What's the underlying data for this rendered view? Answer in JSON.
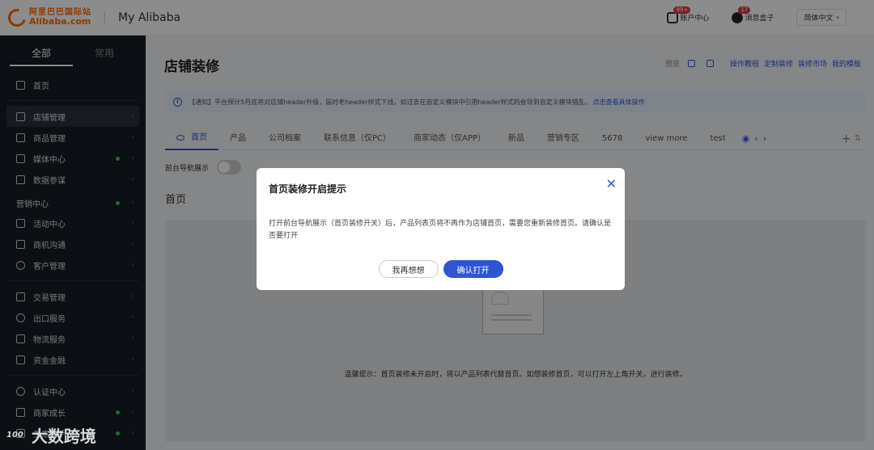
{
  "header": {
    "logo_cn": "阿里巴巴国际站",
    "logo_en": "Alibaba.com",
    "brand": "My Alibaba",
    "account_center": "账户中心",
    "account_badge": "99+",
    "message_box": "消息盒子",
    "message_badge": "17",
    "language": "简体中文"
  },
  "sidebar": {
    "tabs": [
      "全部",
      "常用"
    ],
    "home": "首页",
    "items_a": [
      "店铺管理",
      "商品管理",
      "媒体中心",
      "数据参谋"
    ],
    "group_marketing": "营销中心",
    "items_b": [
      "活动中心",
      "商机沟通",
      "客户管理"
    ],
    "items_c": [
      "交易管理",
      "出口服务",
      "物流服务",
      "资金金融"
    ],
    "items_d": [
      "认证中心",
      "商家成长",
      "生意助手"
    ]
  },
  "main": {
    "title": "店铺装修",
    "preview": "预览",
    "actions": [
      "操作教程",
      "定制装修",
      "装修市场",
      "我的模板"
    ],
    "notice": "【通知】平台预计5月底将对店铺header升级，届时老header样式下线，如过去在自定义模块中引用header样式的会导到自定义模块错乱。",
    "notice_link": "点击查看具体操作",
    "tabs": [
      "首页",
      "产品",
      "公司档案",
      "联系信息（仅PC）",
      "商家动态（仅APP）",
      "新品",
      "营销专区",
      "5678",
      "view more",
      "test"
    ],
    "toggle_label": "前台导航展示",
    "section_title": "首页",
    "empty_tip": "温馨提示：首页装修未开启时，将以产品列表代替首页。如想装修首页，可以打开左上角开关，进行装修。"
  },
  "modal": {
    "title": "首页装修开启提示",
    "body": "打开前台导航展示（首页装修开关）后，产品列表页将不再作为店铺首页，需要您重新装修首页。请确认是否要打开",
    "cancel": "我再想想",
    "confirm": "确认打开"
  },
  "watermark": {
    "logo": "100",
    "text": "大数跨境"
  },
  "colors": {
    "brand_orange": "#ff6a00",
    "primary_blue": "#2f55d4",
    "sidebar_bg": "#171d26",
    "status_green": "#3fc54b"
  }
}
